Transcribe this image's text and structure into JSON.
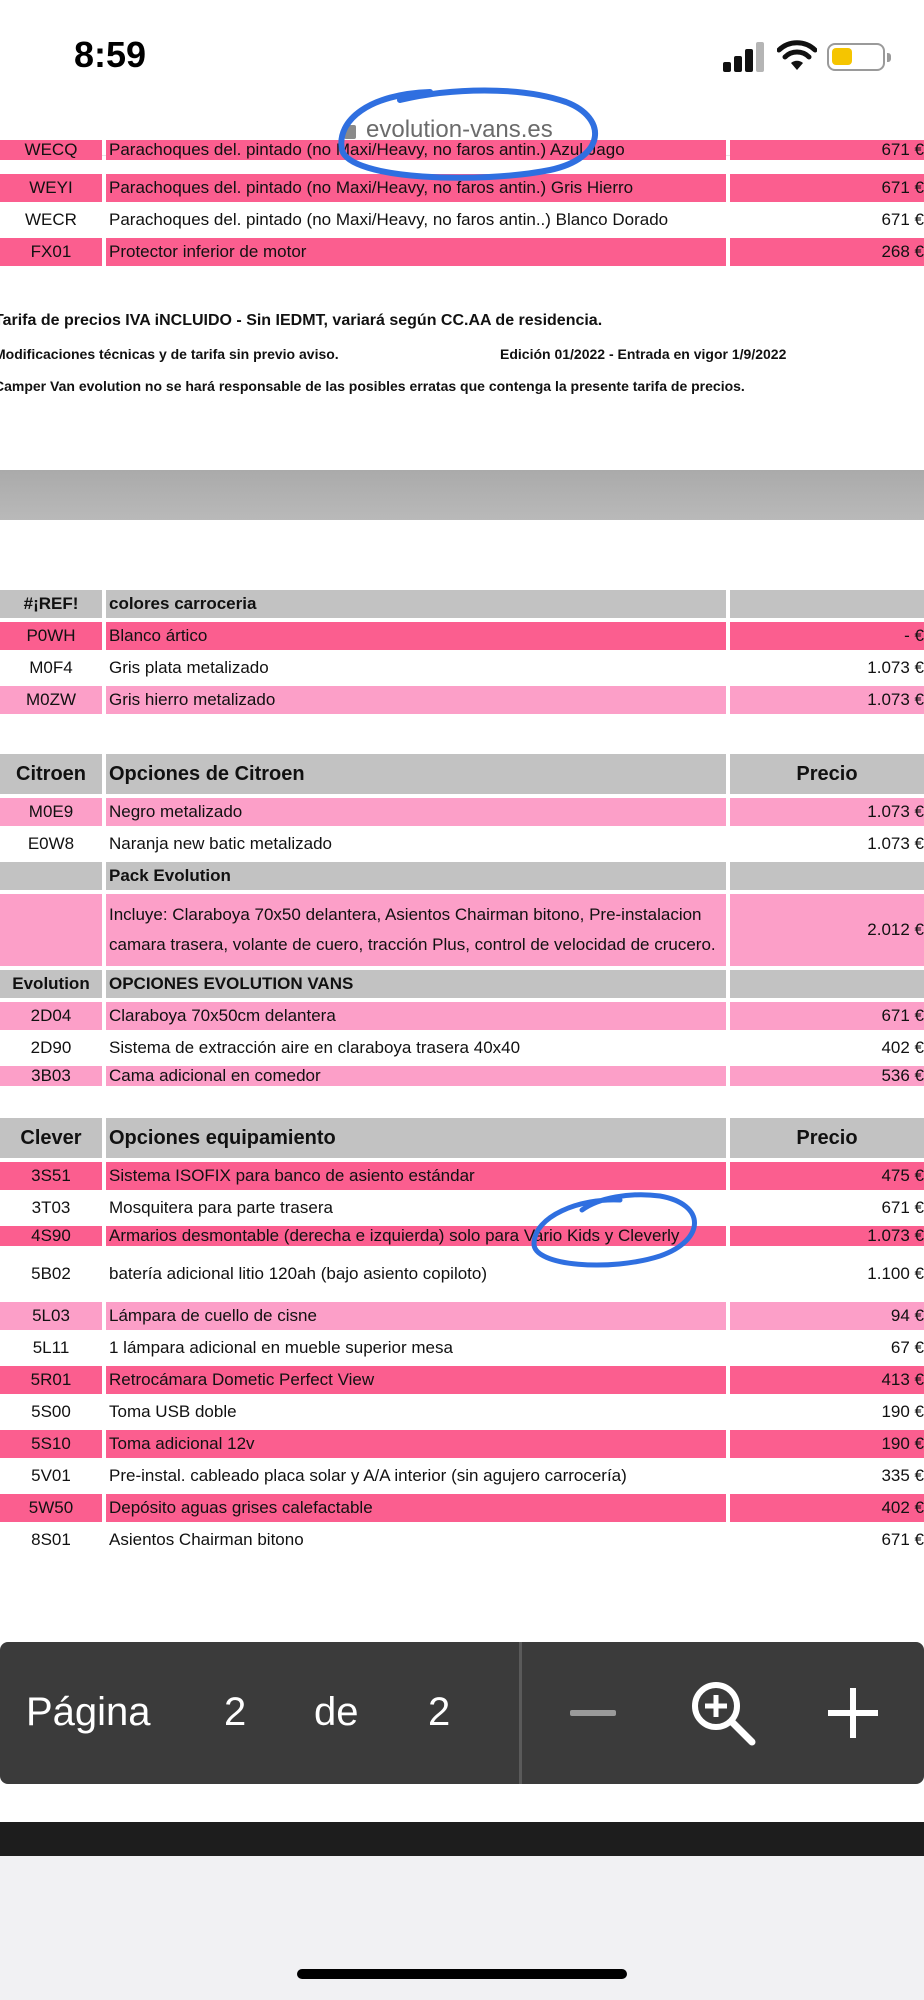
{
  "status_bar": {
    "time": "8:59"
  },
  "browser": {
    "url": "evolution-vans.es"
  },
  "colors": {
    "hot_pink": "#fb5e8f",
    "light_pink": "#fc9fc8",
    "grey": "#c2c2c2",
    "annotation_blue": "#2f6fe0"
  },
  "top_rows": [
    {
      "code": "WECQ",
      "desc": "Parachoques del. pintado (no Maxi/Heavy, no faros antin.) Azul Jago",
      "price": "671 €"
    },
    {
      "code": "WEYI",
      "desc": "Parachoques del. pintado (no Maxi/Heavy, no faros antin.) Gris Hierro",
      "price": "671 €"
    },
    {
      "code": "WECR",
      "desc": "Parachoques del. pintado (no Maxi/Heavy, no faros antin..) Blanco Dorado",
      "price": "671 €"
    },
    {
      "code": "FX01",
      "desc": "Protector inferior de motor",
      "price": "268 €"
    }
  ],
  "notes": {
    "line1": "Tarifa de precios IVA iNCLUIDO - Sin IEDMT, variará según CC.AA de residencia.",
    "line2": "Modificaciones técnicas y de tarifa sin previo aviso.",
    "edition": "Edición 01/2022 - Entrada en vigor 1/9/2022",
    "line3": "Camper Van evolution no se hará responsable de las posibles erratas que contenga la presente tarifa de precios."
  },
  "colores_section": {
    "header_code": "#¡REF!",
    "header_title": "colores carroceria",
    "rows": [
      {
        "code": "P0WH",
        "desc": "Blanco ártico",
        "price": "- €"
      },
      {
        "code": "M0F4",
        "desc": "Gris plata metalizado",
        "price": "1.073 €"
      },
      {
        "code": "M0ZW",
        "desc": "Gris hierro metalizado",
        "price": "1.073 €"
      }
    ]
  },
  "citroen_section": {
    "header_code": "Citroen",
    "header_title": "Opciones de Citroen",
    "header_price": "Precio",
    "rows": [
      {
        "code": "M0E9",
        "desc": "Negro metalizado",
        "price": "1.073 €"
      },
      {
        "code": "E0W8",
        "desc": "Naranja new batic metalizado",
        "price": "1.073 €"
      }
    ],
    "pack_title": "Pack Evolution",
    "pack_desc": "Incluye: Claraboya 70x50 delantera, Asientos Chairman bitono, Pre-instalacion camara trasera, volante de cuero, tracción Plus, control de velocidad de crucero.",
    "pack_price": "2.012 €"
  },
  "evolution_section": {
    "header_code": "Evolution",
    "header_title": "OPCIONES EVOLUTION VANS",
    "rows": [
      {
        "code": "2D04",
        "desc": "Claraboya 70x50cm  delantera",
        "price": "671 €"
      },
      {
        "code": "2D90",
        "desc": "Sistema de extracción aire en claraboya trasera 40x40",
        "price": "402 €"
      },
      {
        "code": "3B03",
        "desc": "Cama adicional en comedor",
        "price": "536 €"
      }
    ]
  },
  "clever_section": {
    "header_code": "Clever",
    "header_title": "Opciones equipamiento",
    "header_price": "Precio",
    "rows": [
      {
        "code": "3S51",
        "desc": "Sistema ISOFIX para banco de asiento estándar",
        "price": "475 €"
      },
      {
        "code": "3T03",
        "desc": "Mosquitera para parte trasera",
        "price": "671 €"
      },
      {
        "code": "4S90",
        "desc": "Armarios desmontable (derecha e izquierda) solo para Vario Kids y Cleverly",
        "price": "1.073 €"
      },
      {
        "code": "5B02",
        "desc": "batería adicional litio 120ah (bajo asiento copiloto)",
        "price": "1.100 €"
      },
      {
        "code": "5L03",
        "desc": "Lámpara de cuello de cisne",
        "price": "94 €"
      },
      {
        "code": "5L11",
        "desc": "1 lámpara adicional en mueble superior mesa",
        "price": "67 €"
      },
      {
        "code": "5R01",
        "desc": "Retrocámara Dometic Perfect View",
        "price": "413 €"
      },
      {
        "code": "5S00",
        "desc": "Toma USB doble",
        "price": "190 €"
      },
      {
        "code": "5S10",
        "desc": "Toma adicional 12v",
        "price": "190 €"
      },
      {
        "code": "5V01",
        "desc": "Pre-instal. cableado placa solar y A/A interior (sin agujero carrocería)",
        "price": "335 €"
      },
      {
        "code": "5W50",
        "desc": "Depósito aguas grises calefactable",
        "price": "402 €"
      },
      {
        "code": "8S01",
        "desc": "Asientos Chairman bitono",
        "price": "671 €"
      }
    ]
  },
  "toolbar": {
    "page_label": "Página",
    "current_page": "2",
    "of_label": "de",
    "total_pages": "2"
  }
}
